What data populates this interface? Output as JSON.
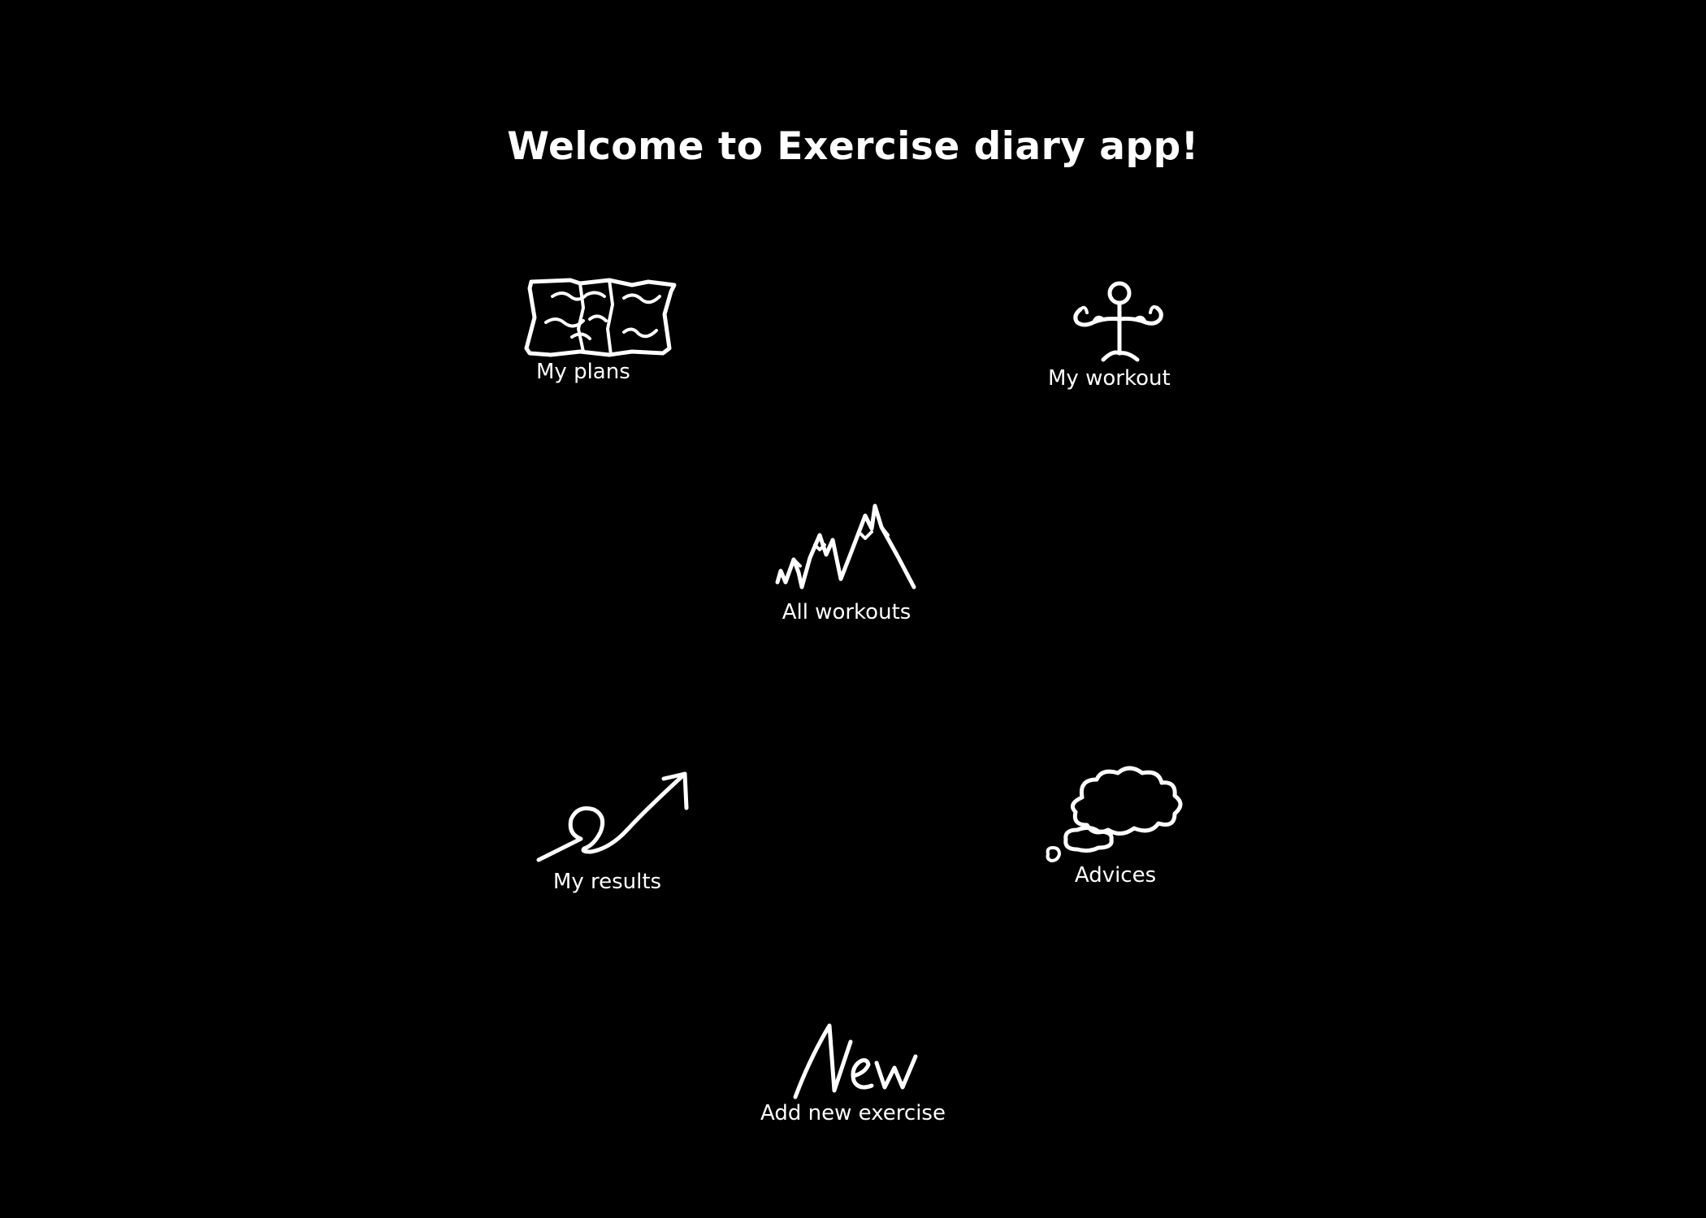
{
  "header": {
    "title": "Welcome to Exercise diary app!"
  },
  "menu": {
    "my_plans": {
      "label": "My plans",
      "icon": "map-icon"
    },
    "my_workout": {
      "label": "My workout",
      "icon": "stick-figure-icon"
    },
    "all_workouts": {
      "label": "All workouts",
      "icon": "mountains-icon"
    },
    "my_results": {
      "label": "My results",
      "icon": "rising-arrow-icon"
    },
    "advices": {
      "label": "Advices",
      "icon": "thought-cloud-icon"
    },
    "add_new": {
      "label": "Add new exercise",
      "icon": "new-scribble-icon",
      "icon_text": "New"
    }
  },
  "colors": {
    "background": "#000000",
    "foreground": "#ffffff"
  }
}
